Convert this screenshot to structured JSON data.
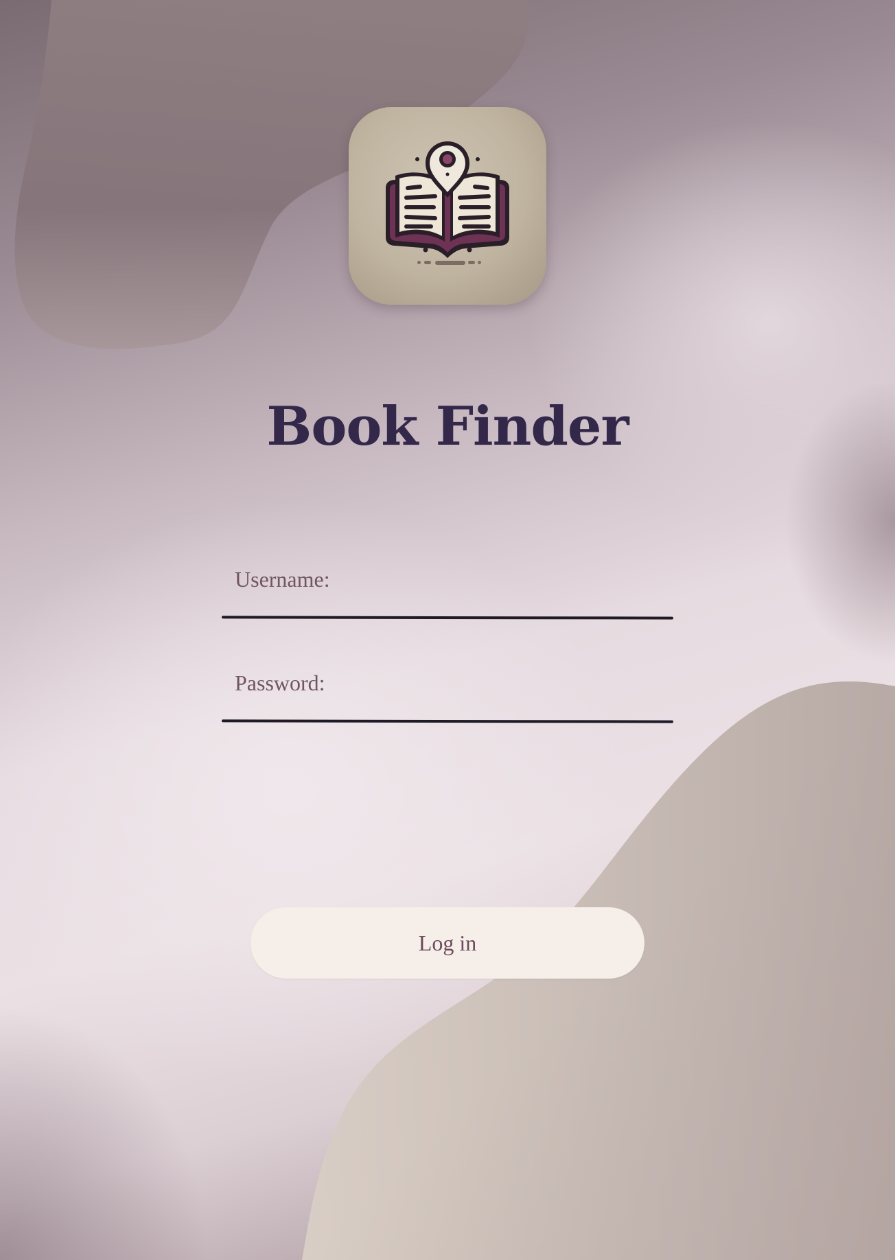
{
  "app": {
    "title": "Book Finder",
    "icon": "book-location-pin-icon"
  },
  "form": {
    "username_label": "Username:",
    "password_label": "Password:",
    "username_value": "",
    "password_value": "",
    "login_label": "Log in"
  },
  "colors": {
    "title": "#33284a",
    "label": "#705562",
    "button_bg": "#f6eee9",
    "button_text": "#6b4b5b",
    "underline": "#1f1a25"
  }
}
